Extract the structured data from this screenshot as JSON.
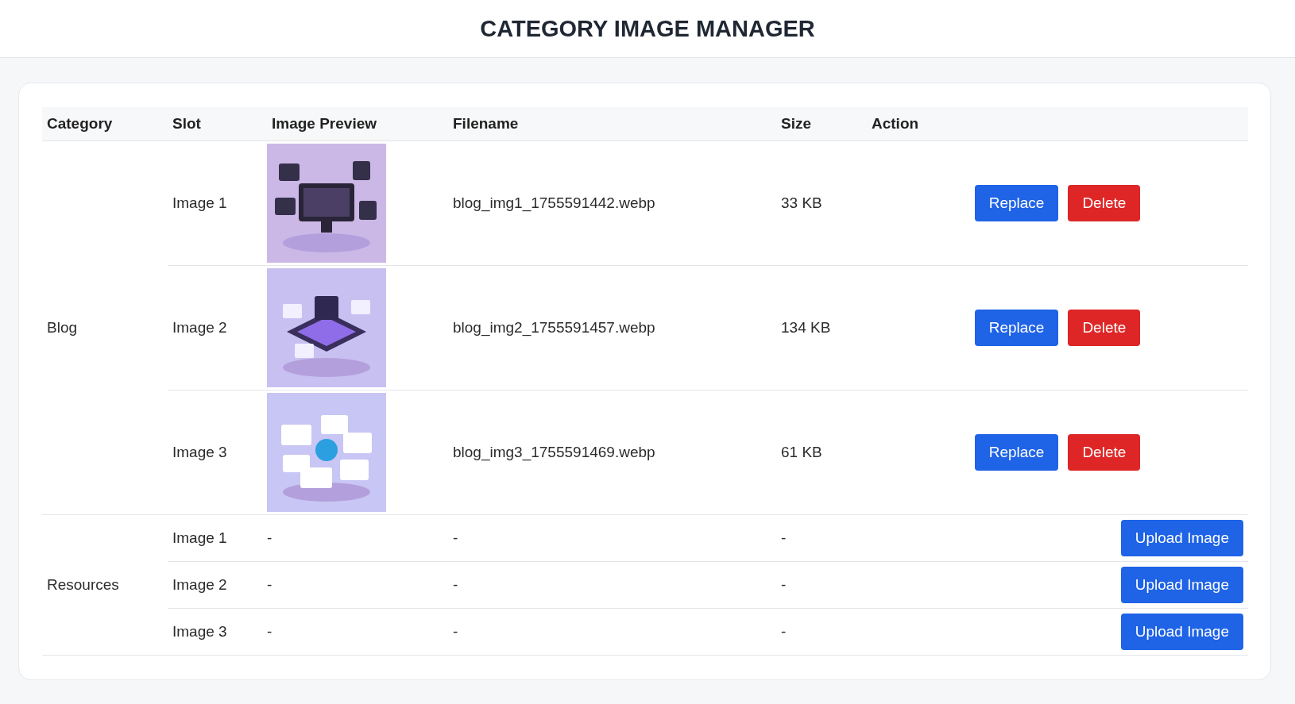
{
  "title": "CATEGORY IMAGE MANAGER",
  "table": {
    "columns": [
      "Category",
      "Slot",
      "Image Preview",
      "Filename",
      "Size",
      "Action"
    ],
    "groups": [
      {
        "category": "Blog",
        "rows": [
          {
            "slot": "Image 1",
            "preview": {
              "kind": "picture"
            },
            "filename": "blog_img1_1755591442.webp",
            "size": "33 KB",
            "actions": [
              {
                "label": "Replace",
                "kind": "replace"
              },
              {
                "label": "Delete",
                "kind": "delete"
              }
            ]
          },
          {
            "slot": "Image 2",
            "preview": {
              "kind": "picture"
            },
            "filename": "blog_img2_1755591457.webp",
            "size": "134 KB",
            "actions": [
              {
                "label": "Replace",
                "kind": "replace"
              },
              {
                "label": "Delete",
                "kind": "delete"
              }
            ]
          },
          {
            "slot": "Image 3",
            "preview": {
              "kind": "picture"
            },
            "filename": "blog_img3_1755591469.webp",
            "size": "61 KB",
            "actions": [
              {
                "label": "Replace",
                "kind": "replace"
              },
              {
                "label": "Delete",
                "kind": "delete"
              }
            ]
          }
        ]
      },
      {
        "category": "Resources",
        "rows": [
          {
            "slot": "Image 1",
            "preview": {
              "kind": "text",
              "text": "-"
            },
            "filename": "-",
            "size": "-",
            "actions": [
              {
                "label": "Upload Image",
                "kind": "upload"
              }
            ]
          },
          {
            "slot": "Image 2",
            "preview": {
              "kind": "text",
              "text": "-"
            },
            "filename": "-",
            "size": "-",
            "actions": [
              {
                "label": "Upload Image",
                "kind": "upload"
              }
            ]
          },
          {
            "slot": "Image 3",
            "preview": {
              "kind": "text",
              "text": "-"
            },
            "filename": "-",
            "size": "-",
            "actions": [
              {
                "label": "Upload Image",
                "kind": "upload"
              }
            ]
          }
        ]
      }
    ]
  }
}
